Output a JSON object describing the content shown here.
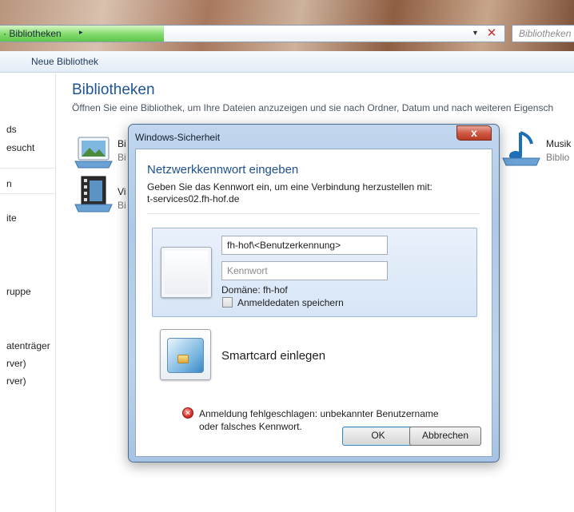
{
  "explorer": {
    "breadcrumb": "· Bibliotheken",
    "breadcrumb_arrow": "▸",
    "search_placeholder": "Bibliotheken",
    "toolbar_new_library": "Neue Bibliothek",
    "nav_items": [
      "ds",
      "esucht",
      "n",
      "ite",
      "ruppe",
      "atenträger",
      "rver)",
      "rver)"
    ],
    "main_title": "Bibliotheken",
    "main_description": "Öffnen Sie eine Bibliothek, um Ihre Dateien anzuzeigen und sie nach Ordner, Datum und nach weiteren Eigensch",
    "libraries": [
      {
        "label": "Bi",
        "sub": "Bi"
      },
      {
        "label": "Vi",
        "sub": "Bi"
      },
      {
        "label": "Musik",
        "sub": "Biblio"
      }
    ]
  },
  "dialog": {
    "title": "Windows-Sicherheit",
    "close_glyph": "x",
    "heading": "Netzwerkkennwort eingeben",
    "subtitle_line1": "Geben Sie das Kennwort ein, um eine Verbindung herzustellen mit:",
    "subtitle_line2": "t-services02.fh-hof.de",
    "username_value": "fh-hof\\<Benutzerkennung>",
    "password_placeholder": "Kennwort",
    "domain_label": "Domäne: fh-hof",
    "remember_label": "Anmeldedaten speichern",
    "remember_checked": false,
    "smartcard_label": "Smartcard einlegen",
    "error_line1": "Anmeldung fehlgeschlagen: unbekannter Benutzername",
    "error_line2": "oder falsches Kennwort.",
    "ok_label": "OK",
    "cancel_label": "Abbrechen"
  },
  "colors": {
    "heading_blue": "#1e5495",
    "dialog_frame": "#aec9e7",
    "close_red": "#d05b46",
    "error_red": "#d9322a"
  },
  "icons": {
    "address_close": "close-icon",
    "error": "error-icon",
    "user_tile": "user-icon",
    "smartcard": "smartcard-icon"
  }
}
